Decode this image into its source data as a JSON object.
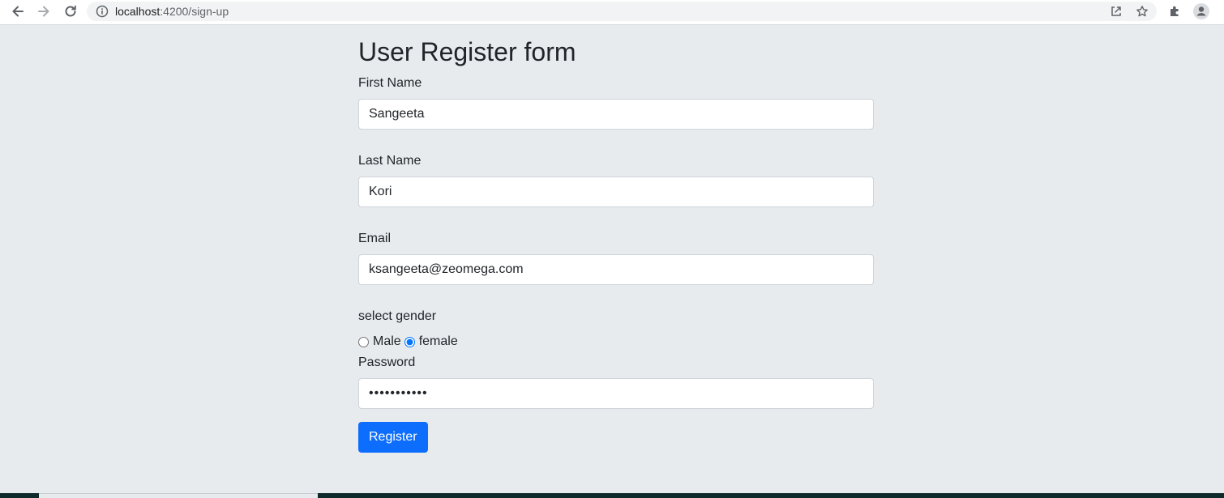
{
  "browser": {
    "url_host": "localhost",
    "url_path": ":4200/sign-up",
    "icons": [
      "back-arrow-icon",
      "forward-arrow-icon",
      "reload-icon",
      "info-icon",
      "share-icon",
      "star-icon",
      "puzzle-extension-icon",
      "profile-avatar-icon"
    ]
  },
  "form": {
    "title": "User Register form",
    "first_name": {
      "label": "First Name",
      "value": "Sangeeta"
    },
    "last_name": {
      "label": "Last Name",
      "value": "Kori"
    },
    "email": {
      "label": "Email",
      "value": "ksangeeta@zeomega.com"
    },
    "gender": {
      "label": "select gender",
      "options": [
        {
          "label": "Male",
          "selected": false
        },
        {
          "label": "female",
          "selected": true
        }
      ]
    },
    "password": {
      "label": "Password",
      "value": "password123"
    },
    "submit_label": "Register"
  },
  "colors": {
    "page_background": "#e8ebee",
    "primary_button": "#0d6efd",
    "input_border": "#ced4da",
    "taskbar": "#0f2a2a"
  }
}
